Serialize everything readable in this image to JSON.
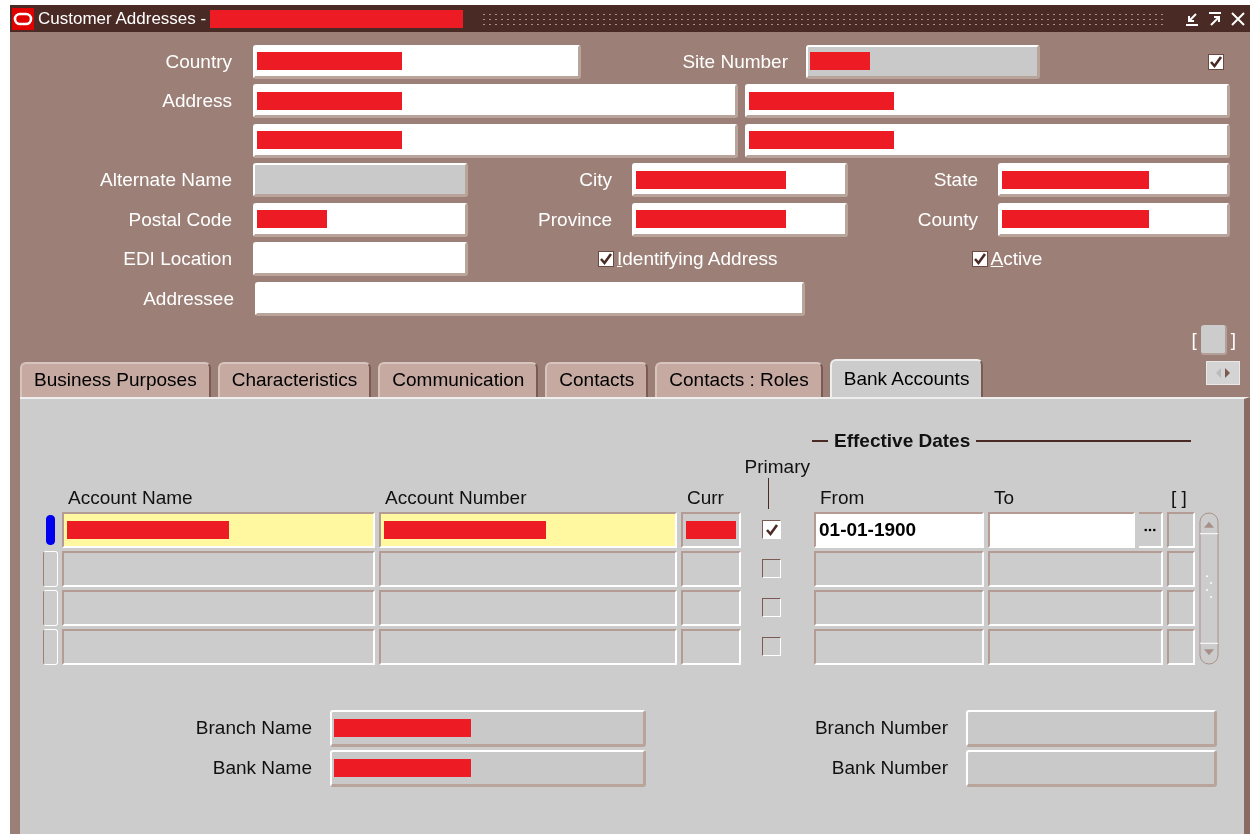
{
  "window": {
    "title": "Customer Addresses -",
    "title_redacted": true
  },
  "header": {
    "country": {
      "label": "Country",
      "redacted": true,
      "disabled": false
    },
    "site_number": {
      "label": "Site Number",
      "redacted": true,
      "disabled": true
    },
    "flag": {
      "checked": true
    },
    "address": {
      "label": "Address"
    },
    "address_lines": [
      {
        "redacted": true,
        "disabled": false
      },
      {
        "redacted": true,
        "disabled": false
      },
      {
        "redacted": true,
        "disabled": false
      },
      {
        "redacted": true,
        "disabled": false
      }
    ],
    "alternate_name": {
      "label": "Alternate Name",
      "redacted": false,
      "disabled": true
    },
    "city": {
      "label": "City",
      "redacted": true,
      "disabled": false
    },
    "state": {
      "label": "State",
      "redacted": true,
      "disabled": false
    },
    "postal_code": {
      "label": "Postal Code",
      "redacted": true,
      "disabled": false
    },
    "province": {
      "label": "Province",
      "redacted": true,
      "disabled": false
    },
    "county": {
      "label": "County",
      "redacted": true,
      "disabled": false
    },
    "edi_location": {
      "label": "EDI Location",
      "redacted": false,
      "disabled": false
    },
    "identifying_address": {
      "label": "Identifying Address",
      "checked": true
    },
    "active": {
      "label": "Active",
      "checked": true
    },
    "addressee": {
      "label": "Addressee",
      "redacted": false,
      "disabled": false
    },
    "record_indicator": {
      "left": "[",
      "right": "]"
    }
  },
  "tabs": [
    {
      "label": "Business Purposes",
      "selected": false
    },
    {
      "label": "Characteristics",
      "selected": false
    },
    {
      "label": "Communication",
      "selected": false
    },
    {
      "label": "Contacts",
      "selected": false
    },
    {
      "label": "Contacts : Roles",
      "selected": false
    },
    {
      "label": "Bank Accounts",
      "selected": true
    }
  ],
  "bank_accounts": {
    "group_title": "Effective Dates",
    "columns": [
      "Account Name",
      "Account Number",
      "Curr",
      "Primary",
      "From",
      "To",
      "[ ]"
    ],
    "rows": [
      {
        "selected": true,
        "account_name_redacted": true,
        "account_number_redacted": true,
        "currency_redacted": true,
        "primary": true,
        "from": "01-01-1900"
      },
      {
        "selected": false,
        "account_name_redacted": false,
        "account_number_redacted": false,
        "currency_redacted": false,
        "primary": false
      },
      {
        "selected": false,
        "account_name_redacted": false,
        "account_number_redacted": false,
        "currency_redacted": false,
        "primary": false
      },
      {
        "selected": false,
        "account_name_redacted": false,
        "account_number_redacted": false,
        "currency_redacted": false,
        "primary": false
      }
    ]
  },
  "bank_details": {
    "branch_name": {
      "label": "Branch Name",
      "redacted": true
    },
    "branch_number": {
      "label": "Branch Number",
      "redacted": false
    },
    "bank_name": {
      "label": "Bank Name",
      "redacted": true
    },
    "bank_number": {
      "label": "Bank Number",
      "redacted": false
    }
  }
}
